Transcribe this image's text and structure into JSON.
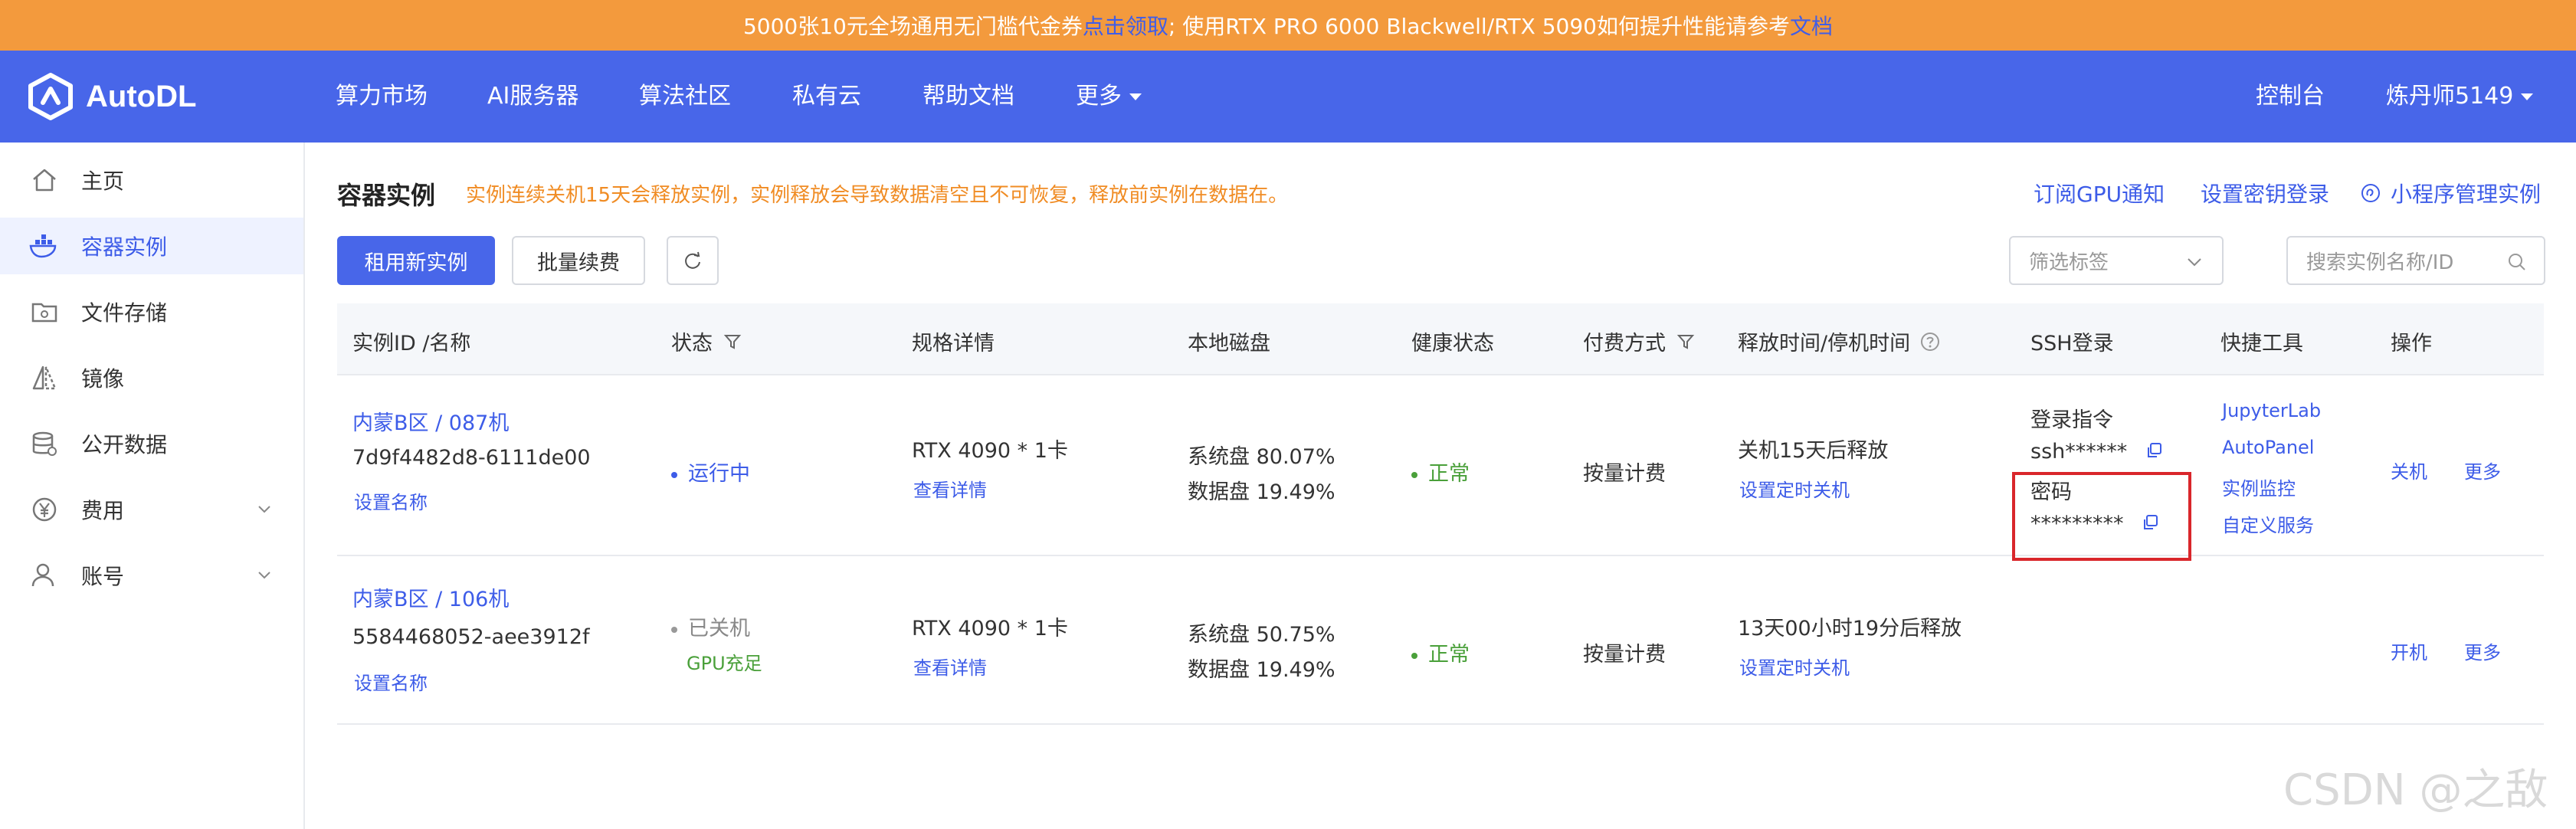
{
  "banner": {
    "part1": "5000张10元全场通用无门槛代金券",
    "link1": "点击领取",
    "part2": "; 使用RTX PRO 6000 Blackwell/RTX 5090如何提升性能请参考",
    "link2": "文档"
  },
  "nav": {
    "logo": "AutoDL",
    "items": [
      "算力市场",
      "AI服务器",
      "算法社区",
      "私有云",
      "帮助文档",
      "更多"
    ],
    "console": "控制台",
    "user": "炼丹师5149"
  },
  "sidebar": {
    "items": [
      {
        "label": "主页",
        "icon": "home-icon"
      },
      {
        "label": "容器实例",
        "icon": "container-icon"
      },
      {
        "label": "文件存储",
        "icon": "folder-icon"
      },
      {
        "label": "镜像",
        "icon": "mirror-icon"
      },
      {
        "label": "公开数据",
        "icon": "database-icon"
      },
      {
        "label": "费用",
        "icon": "yen-icon"
      },
      {
        "label": "账号",
        "icon": "user-icon"
      }
    ]
  },
  "page": {
    "title": "容器实例",
    "notice": "实例连续关机15天会释放实例，实例释放会导致数据清空且不可恢复，释放前实例在数据在。",
    "links": [
      "订阅GPU通知",
      "设置密钥登录",
      "小程序管理实例"
    ]
  },
  "toolbar": {
    "rent": "租用新实例",
    "renew": "批量续费",
    "filter_placeholder": "筛选标签",
    "search_placeholder": "搜索实例名称/ID"
  },
  "table": {
    "headers": [
      "实例ID /名称",
      "状态",
      "规格详情",
      "本地磁盘",
      "健康状态",
      "付费方式",
      "释放时间/停机时间",
      "SSH登录",
      "快捷工具",
      "操作"
    ],
    "rows": [
      {
        "name": "内蒙B区 / 087机",
        "id": "7d9f4482d8-6111de00",
        "set_name": "设置名称",
        "status": "运行中",
        "status_sub": "",
        "spec": "RTX 4090 * 1卡",
        "spec_link": "查看详情",
        "disk_sys": "系统盘 80.07%",
        "disk_data": "数据盘 19.49%",
        "health": "正常",
        "billing": "按量计费",
        "release": "关机15天后释放",
        "release_link": "设置定时关机",
        "ssh_cmd_label": "登录指令",
        "ssh_cmd": "ssh******",
        "ssh_pwd_label": "密码",
        "ssh_pwd": "*********",
        "tools": [
          "JupyterLab",
          "AutoPanel",
          "实例监控",
          "自定义服务"
        ],
        "action": "关机",
        "more": "更多"
      },
      {
        "name": "内蒙B区 / 106机",
        "id": "5584468052-aee3912f",
        "set_name": "设置名称",
        "status": "已关机",
        "status_sub": "GPU充足",
        "spec": "RTX 4090 * 1卡",
        "spec_link": "查看详情",
        "disk_sys": "系统盘 50.75%",
        "disk_data": "数据盘 19.49%",
        "health": "正常",
        "billing": "按量计费",
        "release": "13天00小时19分后释放",
        "release_link": "设置定时关机",
        "action": "开机",
        "more": "更多"
      }
    ]
  },
  "watermark": "CSDN @之敌",
  "colors": {
    "brand": "#4866e9",
    "banner": "#f39a3d",
    "link": "#3d5ce8",
    "ok": "#4aa03a",
    "warn": "#f08c24",
    "highlight": "#d9262b"
  }
}
